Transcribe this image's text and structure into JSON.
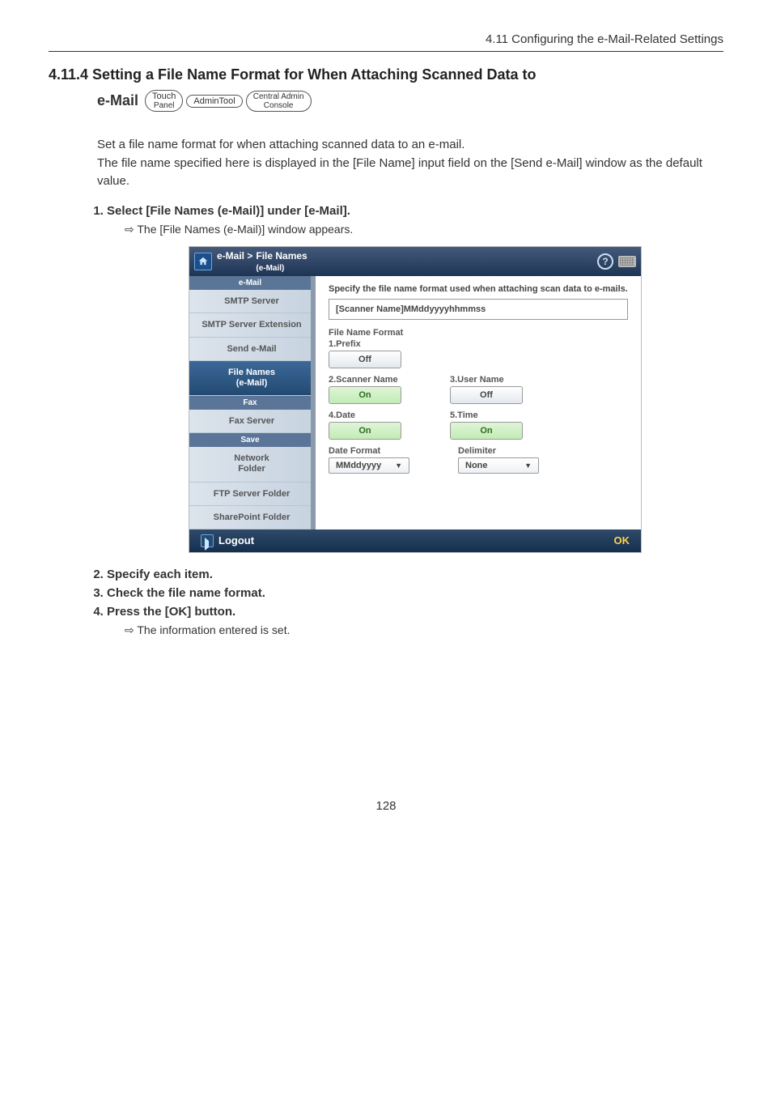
{
  "header_text": "4.11 Configuring the e-Mail-Related Settings",
  "section": {
    "number_title": "4.11.4 Setting a File Name Format for When Attaching Scanned Data to",
    "second_line_label": "e-Mail",
    "badges": {
      "touch1": "Touch",
      "touch2": "Panel",
      "admin": "AdminTool",
      "ca1": "Central Admin",
      "ca2": "Console"
    }
  },
  "intro": {
    "l1": "Set a file name format for when attaching scanned data to an e-mail.",
    "l2": "The file name specified here is displayed in the [File Name] input field on the [Send e-Mail] window as the default value."
  },
  "steps": {
    "s1": "Select [File Names (e-Mail)] under [e-Mail].",
    "s1_sub": "The [File Names (e-Mail)] window appears.",
    "s2": "Specify each item.",
    "s3": "Check the file name format.",
    "s4": "Press the [OK] button.",
    "s4_sub": "The information entered is set."
  },
  "screenshot": {
    "breadcrumb_root": "e-Mail  >",
    "breadcrumb_main": "File Names",
    "breadcrumb_sub": "(e-Mail)",
    "side_cat1": "e-Mail",
    "side": {
      "smtp": "SMTP Server",
      "smtp_ext": "SMTP Server Extension",
      "send": "Send e-Mail",
      "fn1": "File Names",
      "fn2": "(e-Mail)",
      "cat_fax": "Fax",
      "faxsrv": "Fax Server",
      "cat_save": "Save",
      "net1": "Network",
      "net2": "Folder",
      "ftp": "FTP Server Folder",
      "sp": "SharePoint Folder"
    },
    "main": {
      "spec": "Specify the file name format used when attaching scan data to e-mails.",
      "preview": "[Scanner Name]MMddyyyyhhmmss",
      "fmt_label": "File Name Format",
      "f1": "1.Prefix",
      "f1v": "Off",
      "f2": "2.Scanner Name",
      "f2v": "On",
      "f3": "3.User Name",
      "f3v": "Off",
      "f4": "4.Date",
      "f4v": "On",
      "f5": "5.Time",
      "f5v": "On",
      "df_label": "Date Format",
      "df_val": "MMddyyyy",
      "dl_label": "Delimiter",
      "dl_val": "None"
    },
    "footer": {
      "logout": "Logout",
      "ok": "OK"
    }
  },
  "page_number": "128"
}
